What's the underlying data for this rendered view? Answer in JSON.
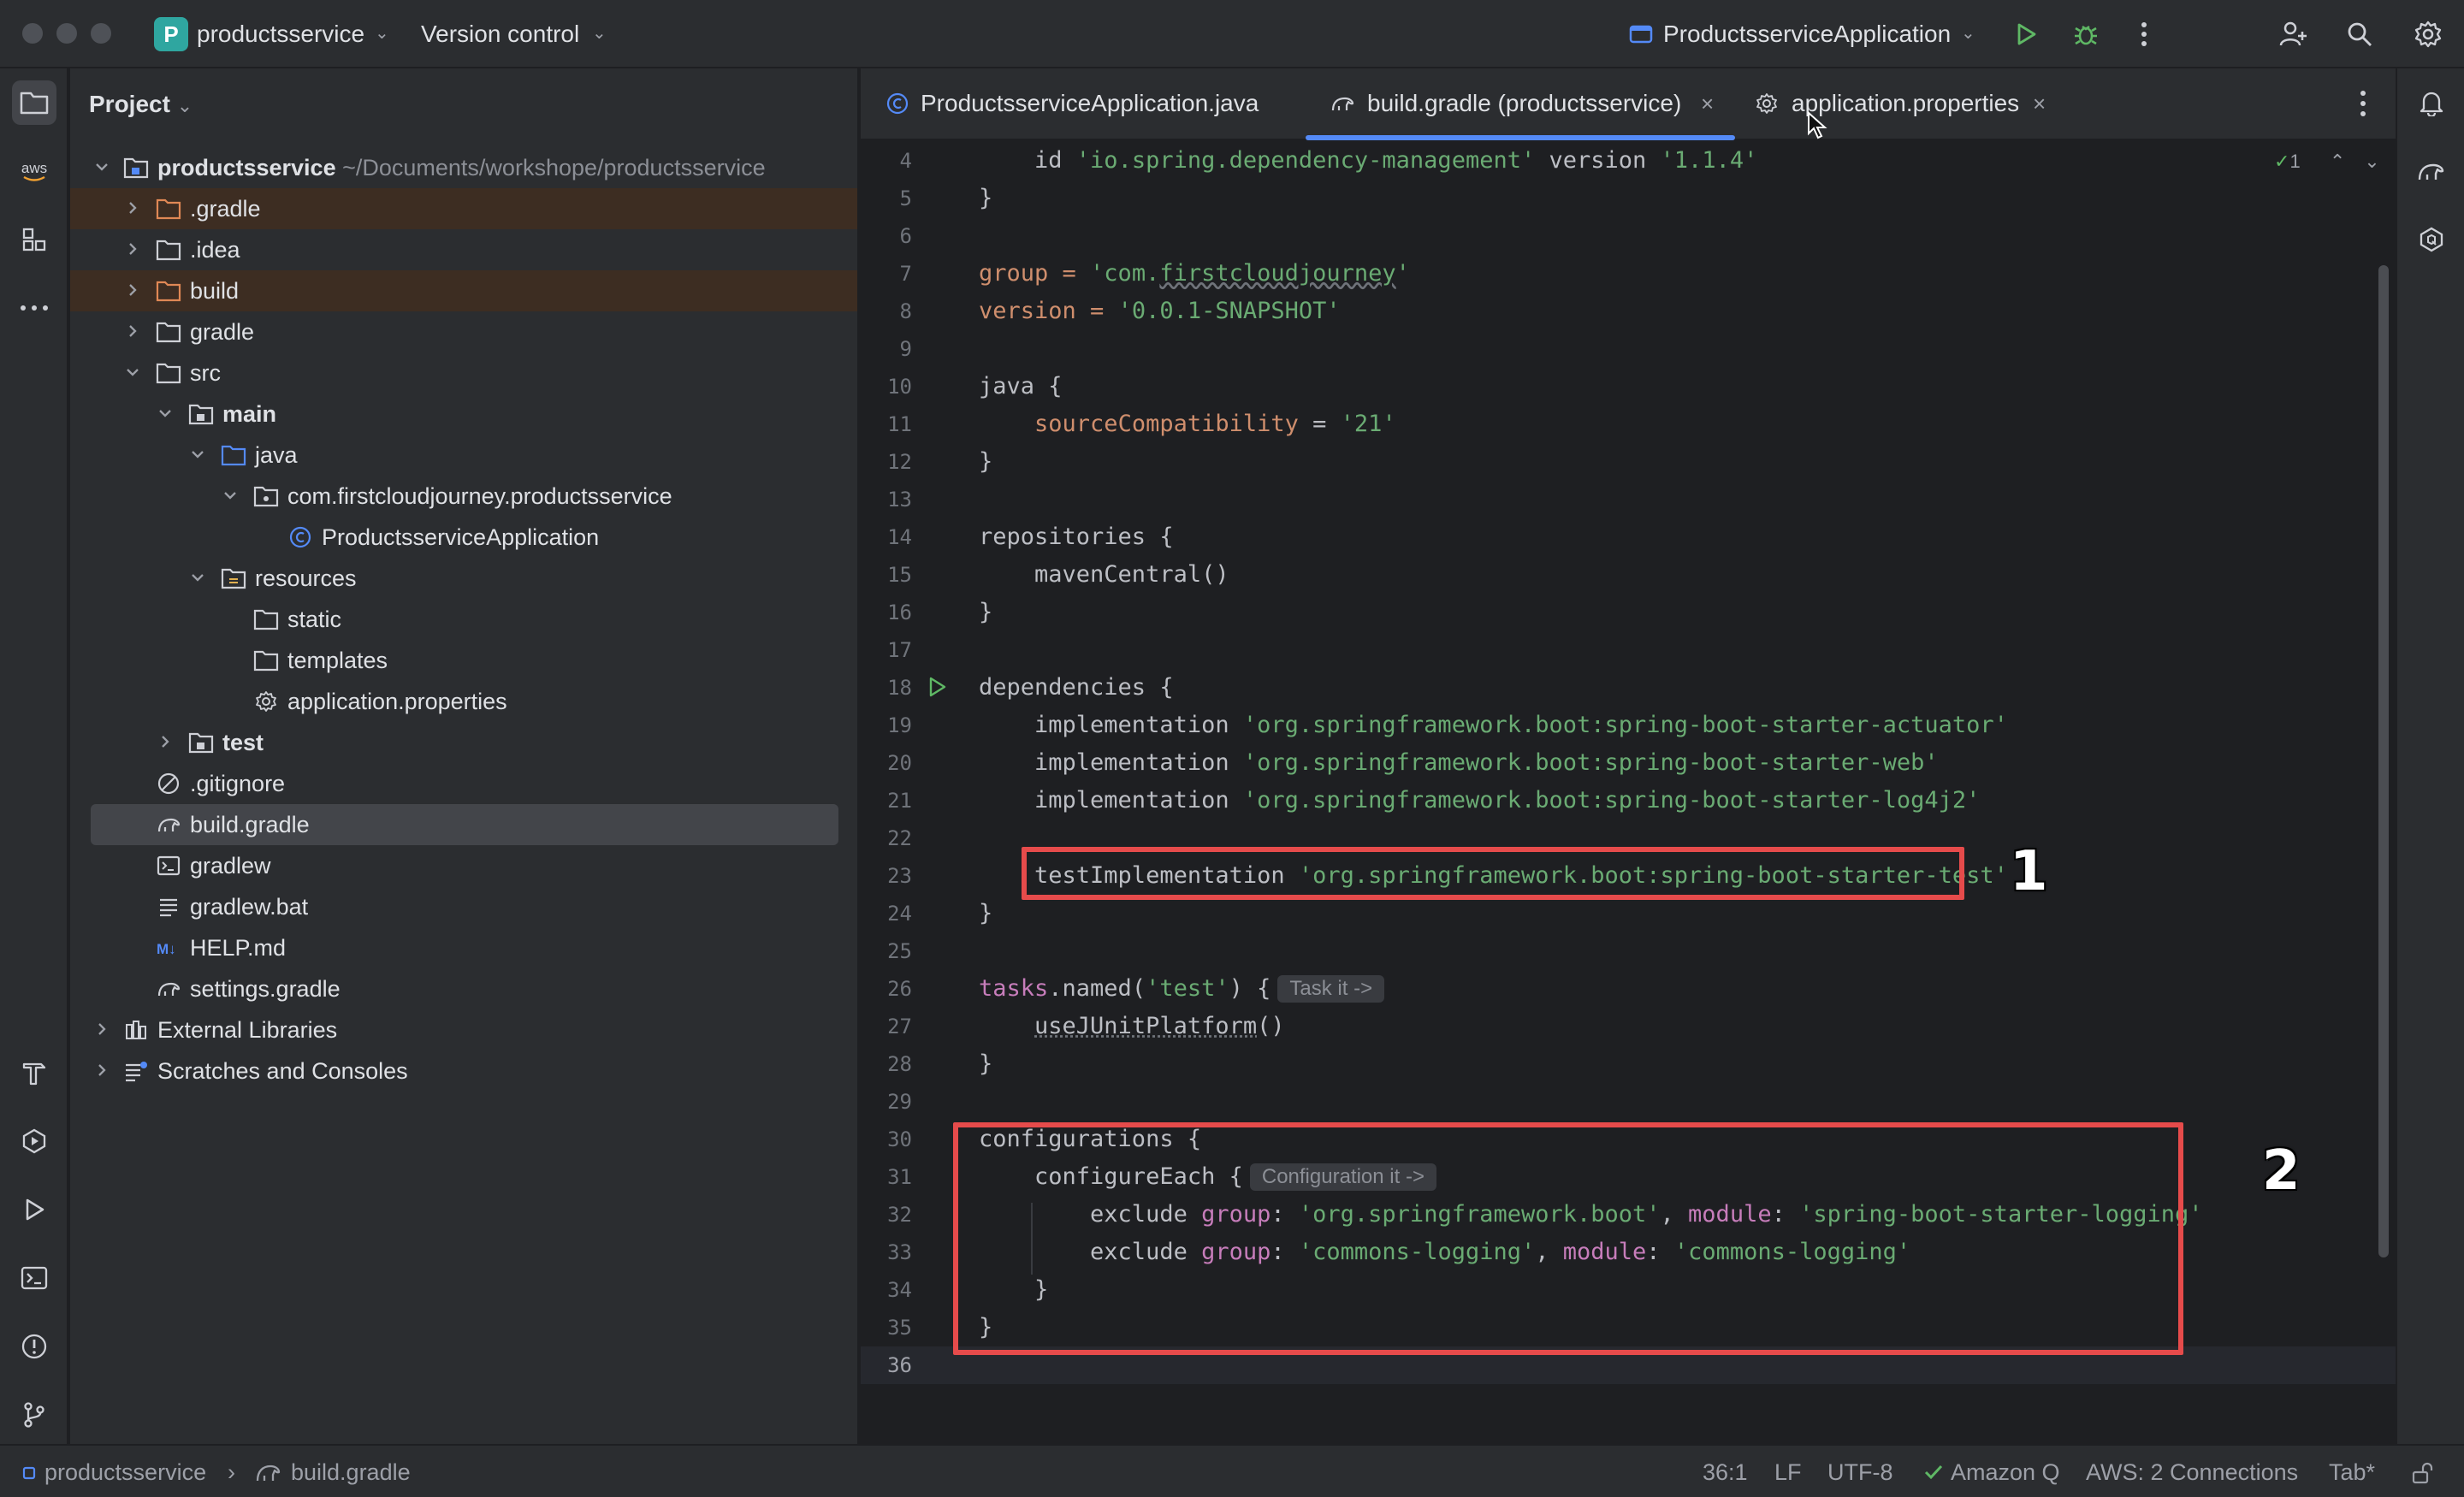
{
  "titlebar": {
    "project_badge": "P",
    "project_name": "productsservice",
    "version_control": "Version control",
    "run_config": "ProductsserviceApplication"
  },
  "project_panel": {
    "header": "Project",
    "root_name": "productsservice",
    "root_path": "~/Documents/workshope/productsservice",
    "items": [
      {
        "label": ".gradle"
      },
      {
        "label": ".idea"
      },
      {
        "label": "build"
      },
      {
        "label": "gradle"
      },
      {
        "label": "src"
      },
      {
        "label": "main"
      },
      {
        "label": "java"
      },
      {
        "label": "com.firstcloudjourney.productsservice"
      },
      {
        "label": "ProductsserviceApplication"
      },
      {
        "label": "resources"
      },
      {
        "label": "static"
      },
      {
        "label": "templates"
      },
      {
        "label": "application.properties"
      },
      {
        "label": "test"
      },
      {
        "label": ".gitignore"
      },
      {
        "label": "build.gradle"
      },
      {
        "label": "gradlew"
      },
      {
        "label": "gradlew.bat"
      },
      {
        "label": "HELP.md"
      },
      {
        "label": "settings.gradle"
      },
      {
        "label": "External Libraries"
      },
      {
        "label": "Scratches and Consoles"
      }
    ]
  },
  "tabs": [
    {
      "label": "ProductsserviceApplication.java"
    },
    {
      "label": "build.gradle (productsservice)"
    },
    {
      "label": "application.properties"
    }
  ],
  "tab_close": "×",
  "editor": {
    "inspection_count": "1",
    "lines": [
      {
        "n": "4",
        "a": "    id ",
        "b": "'io.spring.dependency-management'",
        "c": " version ",
        "d": "'1.1.4'"
      },
      {
        "n": "5",
        "a": "}"
      },
      {
        "n": "6"
      },
      {
        "n": "7",
        "a": "group = ",
        "b": "'com.",
        "c": "firstcloudjourney",
        "d": "'"
      },
      {
        "n": "8",
        "a": "version = ",
        "b": "'0.0.1-SNAPSHOT'"
      },
      {
        "n": "9"
      },
      {
        "n": "10",
        "a": "java {"
      },
      {
        "n": "11",
        "a": "    ",
        "b": "sourceCompatibility",
        "c": " = ",
        "d": "'21'"
      },
      {
        "n": "12",
        "a": "}"
      },
      {
        "n": "13"
      },
      {
        "n": "14",
        "a": "repositories {"
      },
      {
        "n": "15",
        "a": "    mavenCentral()"
      },
      {
        "n": "16",
        "a": "}"
      },
      {
        "n": "17"
      },
      {
        "n": "18",
        "a": "dependencies {"
      },
      {
        "n": "19",
        "a": "    implementation ",
        "b": "'org.springframework.boot:spring-boot-starter-actuator'"
      },
      {
        "n": "20",
        "a": "    implementation ",
        "b": "'org.springframework.boot:spring-boot-starter-web'"
      },
      {
        "n": "21",
        "a": "    implementation ",
        "b": "'org.springframework.boot:spring-boot-starter-log4j2'"
      },
      {
        "n": "22"
      },
      {
        "n": "23",
        "a": "    testImplementation ",
        "b": "'org.springframework.boot:spring-boot-starter-test'"
      },
      {
        "n": "24",
        "a": "}"
      },
      {
        "n": "25"
      },
      {
        "n": "26",
        "a": "tasks",
        "b": ".named(",
        "c": "'test'",
        "d": ") {",
        "hint": "Task it ->"
      },
      {
        "n": "27",
        "a": "    ",
        "b": "useJUnitPlatform",
        "c": "()"
      },
      {
        "n": "28",
        "a": "}"
      },
      {
        "n": "29"
      },
      {
        "n": "30",
        "a": "configurations {"
      },
      {
        "n": "31",
        "a": "    configureEach {",
        "hint": "Configuration it ->"
      },
      {
        "n": "32",
        "a": "        exclude ",
        "b": "group",
        "c": ": ",
        "d": "'org.springframework.boot'",
        "e": ", ",
        "f": "module",
        "g": ": ",
        "h": "'spring-boot-starter-logging'"
      },
      {
        "n": "33",
        "a": "        exclude ",
        "b": "group",
        "c": ": ",
        "d": "'commons-logging'",
        "e": ", ",
        "f": "module",
        "g": ": ",
        "h": "'commons-logging'"
      },
      {
        "n": "34",
        "a": "    }"
      },
      {
        "n": "35",
        "a": "}"
      },
      {
        "n": "36"
      }
    ]
  },
  "annotations": {
    "one": "1",
    "two": "2"
  },
  "statusbar": {
    "crumb_project": "productsservice",
    "crumb_file": "build.gradle",
    "position": "36:1",
    "line_sep": "LF",
    "encoding": "UTF-8",
    "amazon_q": "Amazon Q",
    "aws": "AWS: 2 Connections",
    "indent": "Tab*"
  }
}
